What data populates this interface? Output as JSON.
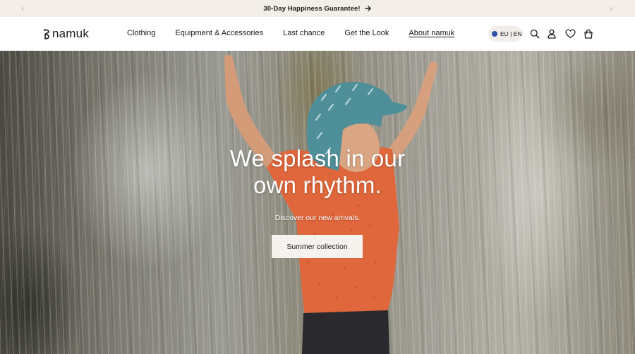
{
  "announcement": {
    "text": "30-Day Happiness Guarantee!",
    "prev_glyph": "‹",
    "next_glyph": "›"
  },
  "header": {
    "logo_text": "namuk",
    "nav": [
      {
        "label": "Clothing"
      },
      {
        "label": "Equipment & Accessories"
      },
      {
        "label": "Last chance"
      },
      {
        "label": "Get the Look"
      },
      {
        "label": "About namuk"
      }
    ],
    "locale": "EU | EN",
    "icons": [
      "search-icon",
      "account-icon",
      "heart-icon",
      "shopping-bag-icon"
    ]
  },
  "hero": {
    "title": "We splash in our own rhythm.",
    "subtitle": "Discover our new arrivals.",
    "cta_label": "Summer collection"
  },
  "colors": {
    "announcement_bg": "#f3efe8",
    "locale_pill_bg": "#f1eee9",
    "locale_dot": "#2b4ea8",
    "cta_bg": "#f6f3ee",
    "shirt_orange": "#e0673c",
    "hat_teal": "#4f8f99"
  }
}
